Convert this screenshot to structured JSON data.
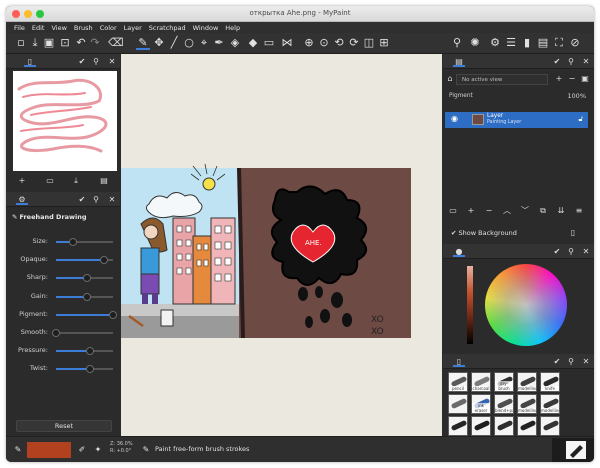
{
  "window": {
    "title": "открытка Ahe.png - MyPaint"
  },
  "menu": [
    "File",
    "Edit",
    "View",
    "Brush",
    "Color",
    "Layer",
    "Scratchpad",
    "Window",
    "Help"
  ],
  "toolbar": {
    "left": [
      "new-file-icon",
      "open-file-icon",
      "save-file-icon",
      "export-icon",
      "undo-icon",
      "redo-icon",
      "eraser-icon"
    ],
    "tools": [
      "freehand-brush-icon",
      "pan-icon",
      "line-icon",
      "ellipse-icon",
      "pick-icon",
      "fill-icon",
      "inking-icon",
      "frame-icon",
      "symmetry-icon",
      "zoom-in-icon",
      "zoom-out-icon",
      "rotate-left-icon",
      "rotate-right-icon",
      "mirror-icon",
      "fit-icon"
    ],
    "right": [
      "brushes-menu-icon",
      "settings-icon",
      "layers-icon",
      "color-menu-icon",
      "fullscreen-icon",
      "help-icon"
    ]
  },
  "scratchpad": {
    "buttons": [
      "add-icon",
      "open-icon",
      "save-icon",
      "new-icon"
    ]
  },
  "brush_editor": {
    "title": "Freehand Drawing",
    "params": [
      {
        "label": "Size:",
        "value": 0.3
      },
      {
        "label": "Opaque:",
        "value": 0.85
      },
      {
        "label": "Sharp:",
        "value": 0.55
      },
      {
        "label": "Gain:",
        "value": 0.55
      },
      {
        "label": "Pigment:",
        "value": 1.0
      },
      {
        "label": "Smooth:",
        "value": 0.0
      },
      {
        "label": "Pressure:",
        "value": 0.6
      },
      {
        "label": "Twist:",
        "value": 0.6
      }
    ],
    "reset_label": "Reset"
  },
  "layers": {
    "view_select": "No active view",
    "blend_mode": "Pigment",
    "opacity": "100%",
    "items": [
      {
        "name": "Layer",
        "type": "Painting Layer"
      }
    ],
    "show_background_label": "Show Background"
  },
  "brushes": {
    "items": [
      "pencil",
      "charcoal",
      "dry-brush",
      "modelling",
      "knife",
      "",
      "ink eraser",
      "blend+paint",
      "modelling",
      "modelling",
      "",
      "",
      "",
      "",
      ""
    ]
  },
  "status": {
    "zoom_line1": "Z: 36.0%",
    "zoom_line2": "R: +0.0°",
    "message": "Paint free-form brush strokes"
  },
  "colors": {
    "accent": "#3d7dd8",
    "current_color": "#b2421f",
    "layer_selected": "#2e6dc4"
  }
}
